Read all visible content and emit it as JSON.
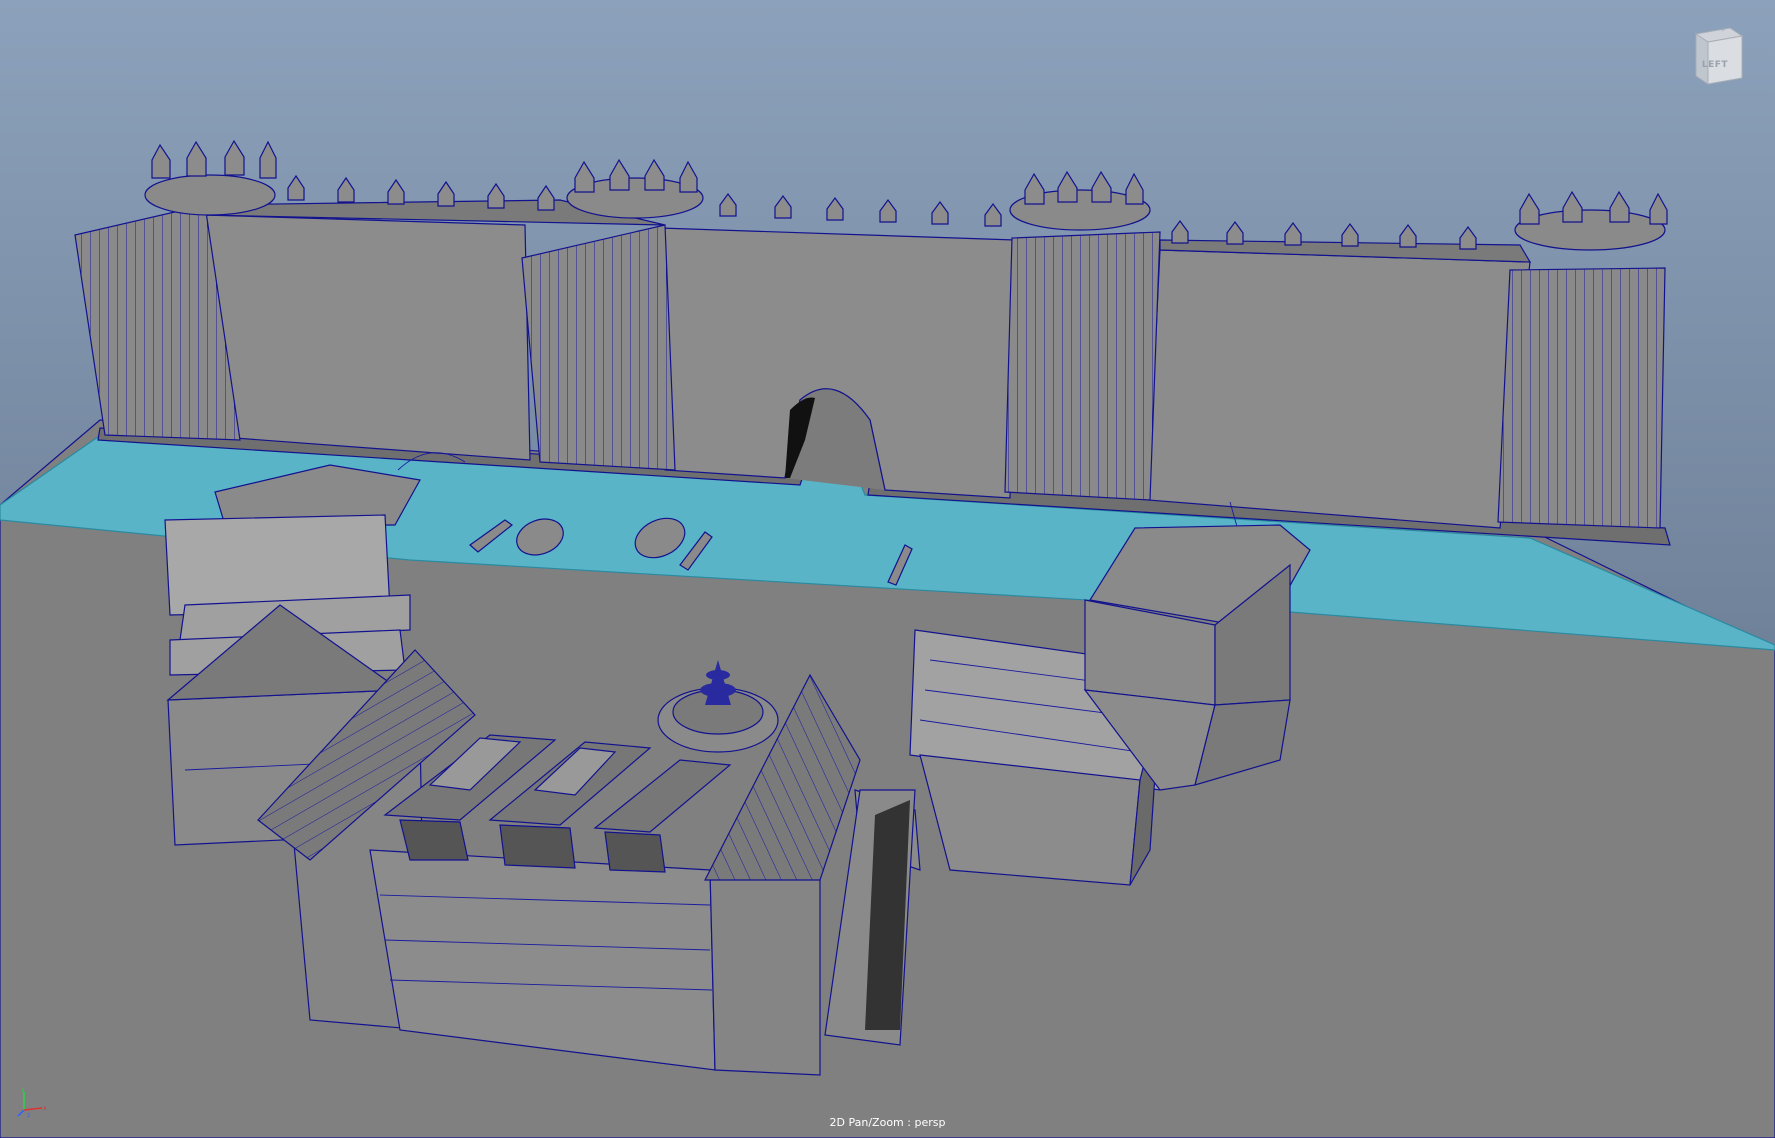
{
  "viewport": {
    "camera_label": "2D Pan/Zoom : persp",
    "background_top": "#8aa0ba",
    "background_bottom": "#5e6e82",
    "ground_color": "#7f7f7f",
    "water_color": "#5ab4c8",
    "wireframe_color": "#12128f"
  },
  "viewcube": {
    "face_label": "LEFT",
    "icon": "view-cube-icon"
  },
  "axis_gizmo": {
    "x_label": "x",
    "y_label": "y",
    "z_label": "z",
    "icon": "axis-gizmo-icon"
  }
}
